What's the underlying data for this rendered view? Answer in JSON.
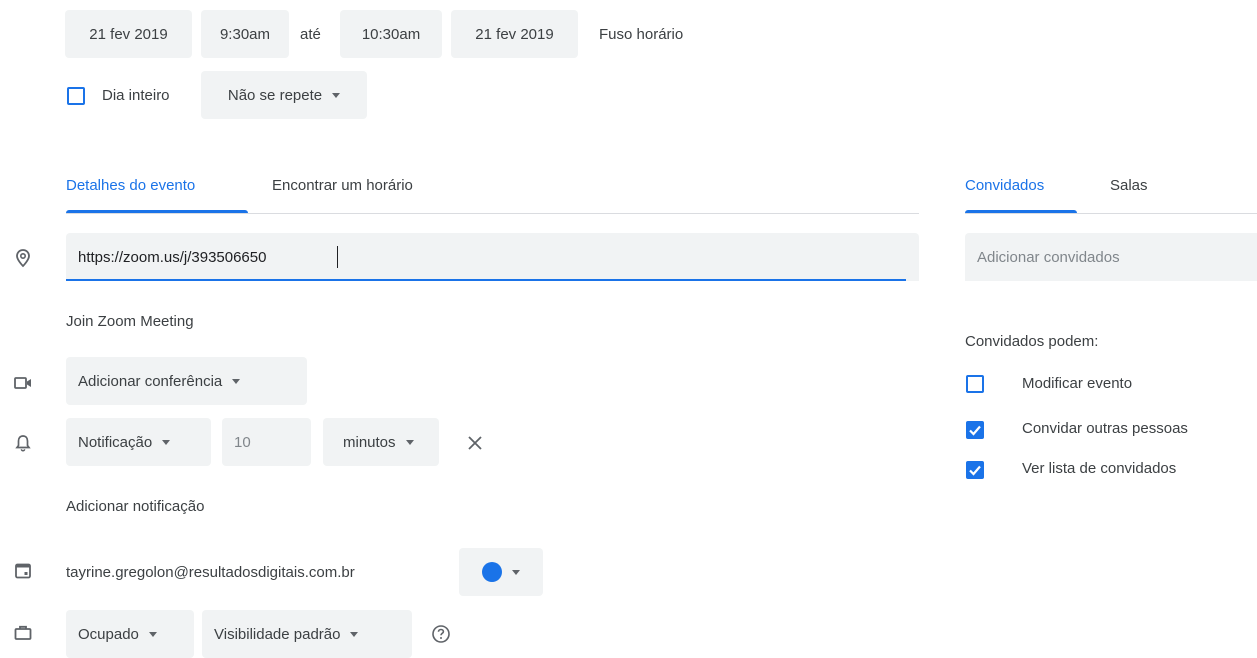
{
  "datetime": {
    "start_date": "21 fev 2019",
    "start_time": "9:30am",
    "until": "até",
    "end_time": "10:30am",
    "end_date": "21 fev 2019",
    "timezone": "Fuso horário"
  },
  "options": {
    "all_day_label": "Dia inteiro",
    "all_day_checked": false,
    "repeat": "Não se repete"
  },
  "tabs": {
    "details": "Detalhes do evento",
    "find_time": "Encontrar um horário"
  },
  "location": {
    "value": "https://zoom.us/j/393506650"
  },
  "description": "Join Zoom Meeting",
  "conference": {
    "label": "Adicionar conferência"
  },
  "notification": {
    "type": "Notificação",
    "amount": "10",
    "unit": "minutos",
    "add_label": "Adicionar notificação"
  },
  "calendar": {
    "owner": "tayrine.gregolon@resultadosdigitais.com.br",
    "color": "#1a73e8"
  },
  "status": {
    "availability": "Ocupado",
    "visibility": "Visibilidade padrão"
  },
  "guests_panel": {
    "tab_guests": "Convidados",
    "tab_rooms": "Salas",
    "add_placeholder": "Adicionar convidados",
    "permissions_title": "Convidados podem:",
    "permissions": [
      {
        "label": "Modificar evento",
        "checked": false
      },
      {
        "label": "Convidar outras pessoas",
        "checked": true
      },
      {
        "label": "Ver lista de convidados",
        "checked": true
      }
    ]
  },
  "colors": {
    "accent": "#1a73e8",
    "chip_bg": "#f1f3f4",
    "text": "#3c4043"
  }
}
